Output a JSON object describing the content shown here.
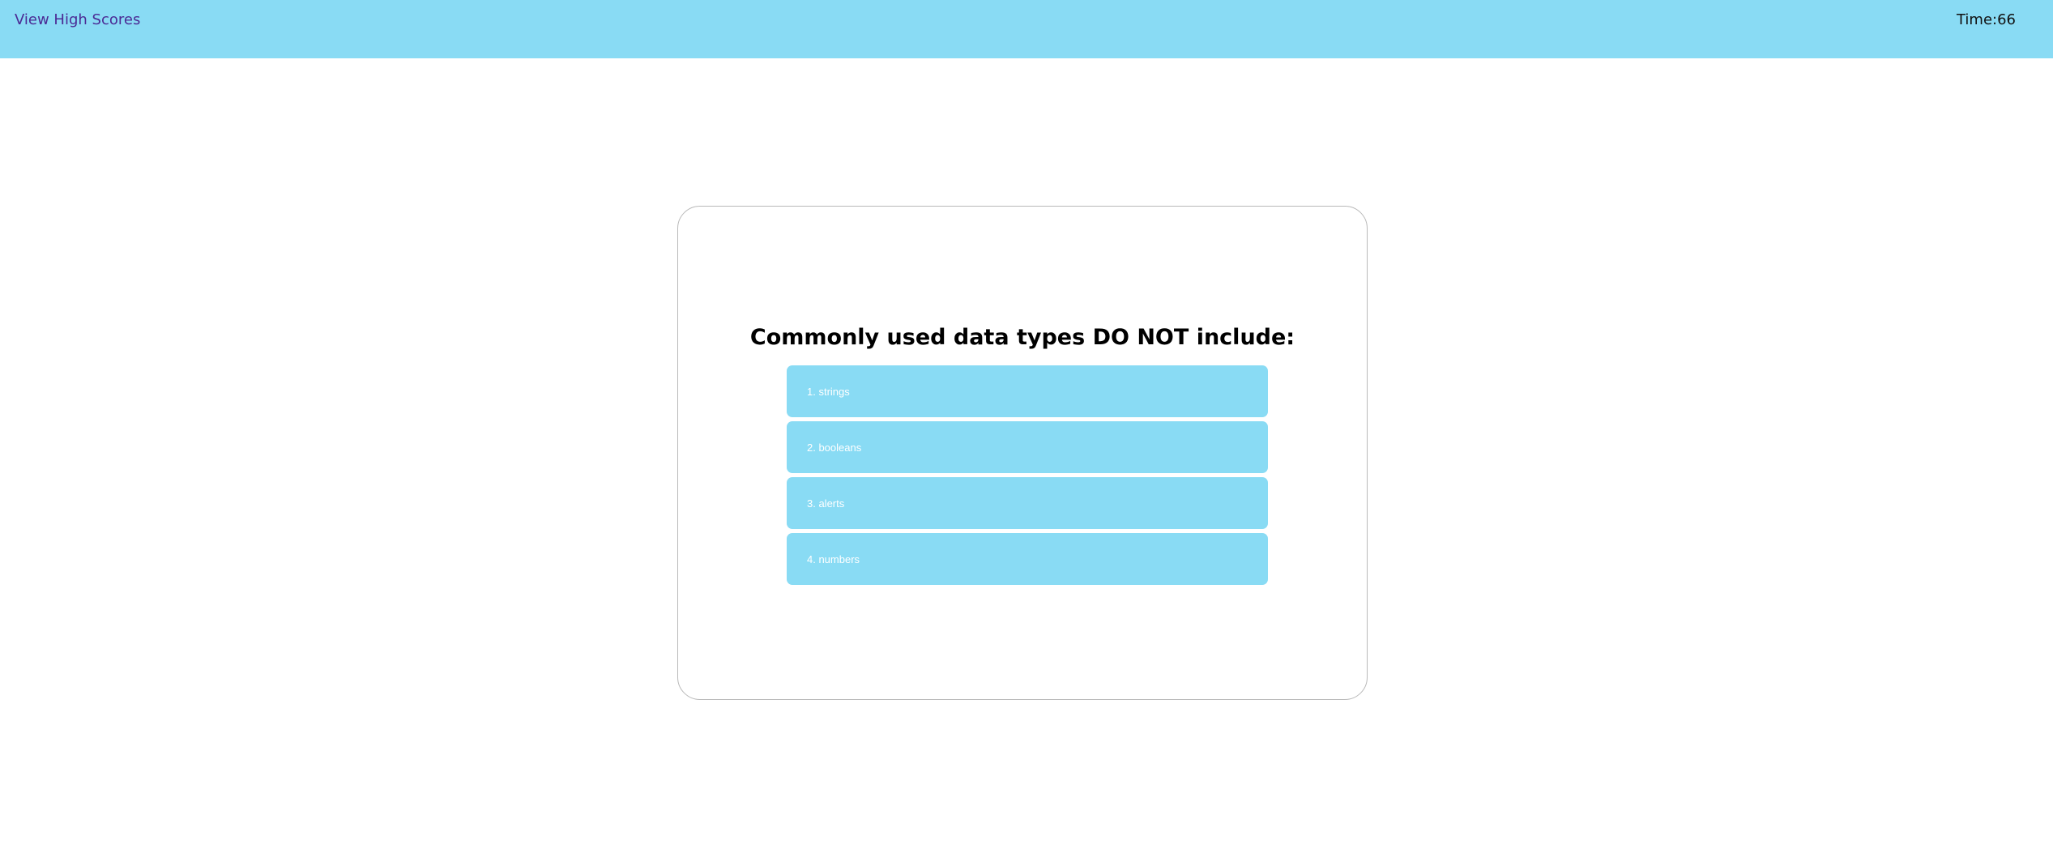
{
  "header": {
    "high_scores_label": "View High Scores",
    "timer_label": "Time:",
    "timer_value": "66"
  },
  "quiz": {
    "question": "Commonly used data types DO NOT include:",
    "answers": [
      {
        "label": "1. strings"
      },
      {
        "label": "2. booleans"
      },
      {
        "label": "3. alerts"
      },
      {
        "label": "4. numbers"
      }
    ]
  },
  "colors": {
    "accent": "#89dbf4",
    "link": "#4b2a94",
    "card_border": "#b9b9b9",
    "answer_text": "#ffffff"
  }
}
